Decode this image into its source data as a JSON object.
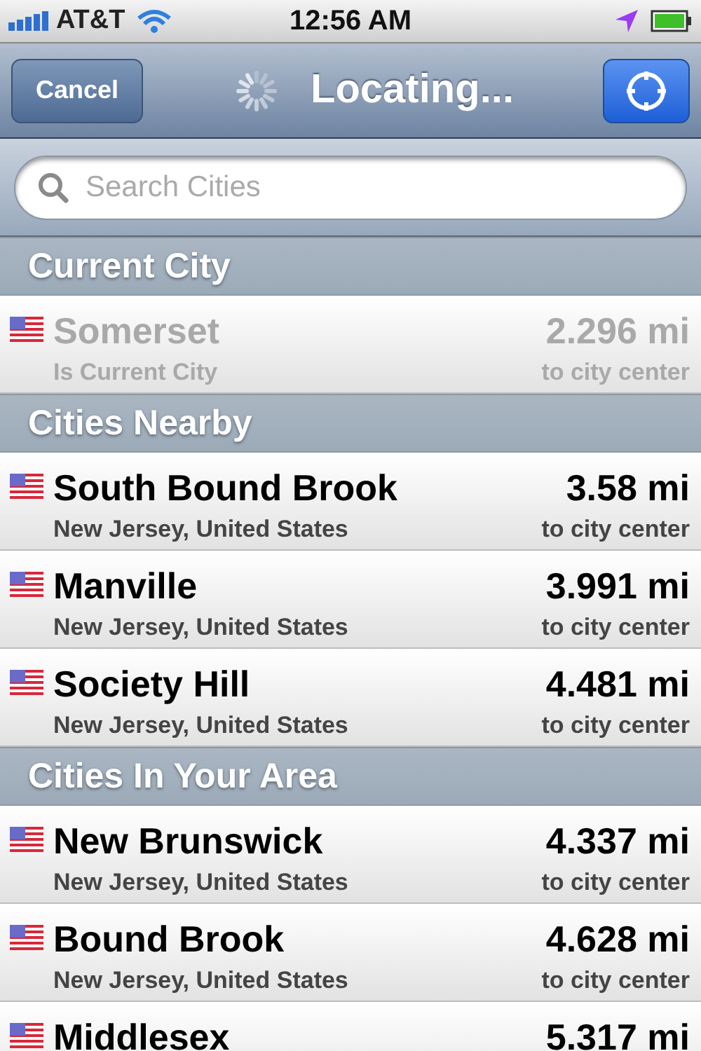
{
  "status_bar": {
    "carrier": "AT&T",
    "time": "12:56 AM"
  },
  "nav_bar": {
    "cancel": "Cancel",
    "title": "Locating..."
  },
  "search": {
    "placeholder": "Search Cities"
  },
  "sections": [
    {
      "title": "Current City",
      "rows": [
        {
          "name": "Somerset",
          "subtitle": "Is Current City",
          "distance": "2.296 mi",
          "caption": "to city center",
          "disabled": true
        }
      ]
    },
    {
      "title": "Cities Nearby",
      "rows": [
        {
          "name": "South Bound Brook",
          "subtitle": "New Jersey, United States",
          "distance": "3.58 mi",
          "caption": "to city center",
          "disabled": false
        },
        {
          "name": "Manville",
          "subtitle": "New Jersey, United States",
          "distance": "3.991 mi",
          "caption": "to city center",
          "disabled": false
        },
        {
          "name": "Society Hill",
          "subtitle": "New Jersey, United States",
          "distance": "4.481 mi",
          "caption": "to city center",
          "disabled": false
        }
      ]
    },
    {
      "title": "Cities In Your Area",
      "rows": [
        {
          "name": "New Brunswick",
          "subtitle": "New Jersey, United States",
          "distance": "4.337 mi",
          "caption": "to city center",
          "disabled": false
        },
        {
          "name": "Bound Brook",
          "subtitle": "New Jersey, United States",
          "distance": "4.628 mi",
          "caption": "to city center",
          "disabled": false
        },
        {
          "name": "Middlesex",
          "distance": "5.317 mi",
          "disabled": false
        }
      ]
    }
  ]
}
